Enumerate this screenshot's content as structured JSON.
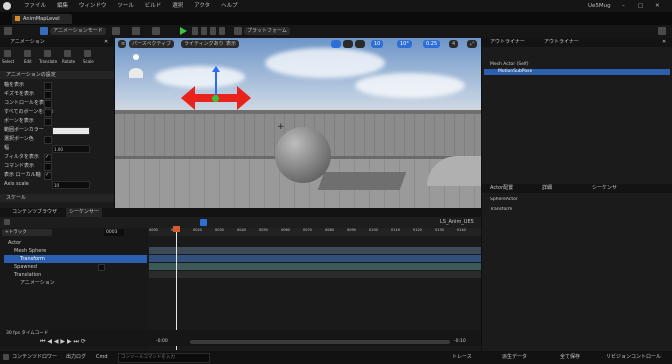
{
  "menubar": {
    "items": [
      "ファイル",
      "編集",
      "ウィンドウ",
      "ツール",
      "ビルド",
      "選択",
      "アクタ",
      "ヘルプ"
    ],
    "project": "Ue5Mug"
  },
  "tab": {
    "label": "AnimMapLevel"
  },
  "toolbar": {
    "mode_label": "アニメーションモード",
    "platform_label": "プラットフォーム"
  },
  "left_panel": {
    "title": "アニメーション",
    "tools": [
      "Select",
      "Edit",
      "Translate",
      "Rotate",
      "Scale"
    ],
    "section": "アニメーションの設定",
    "rows": [
      {
        "label": "軸を表示",
        "check": true
      },
      {
        "label": "ギズモを表示",
        "check": true
      },
      {
        "label": "コントロールを表示",
        "check": true
      },
      {
        "label": "すべてのボーンを表示",
        "check": false
      },
      {
        "label": "ボーンを表示",
        "check": false
      },
      {
        "label": "範囲ボーンカラー",
        "value": "swatch"
      },
      {
        "label": "選択ボーン色",
        "value": ""
      },
      {
        "label": "幅",
        "value": "1.00"
      },
      {
        "label": "フィルタを表示",
        "check": true
      },
      {
        "label": "コマンド表示",
        "check": false
      },
      {
        "label": "表示 ローカル軸",
        "check": true
      },
      {
        "label": "Axis scale",
        "value": "10"
      }
    ],
    "footer": "スケール"
  },
  "viewport": {
    "buttons": [
      "パースペクティブ",
      "ライティングあり",
      "表示"
    ],
    "snap_values": [
      "10",
      "10°",
      "0.25",
      "4"
    ]
  },
  "outliner": {
    "tabs": [
      "アウトライナー",
      "アウトライナー"
    ],
    "items": [
      "Mesh Actor (Self)",
      "MotionSubPose"
    ],
    "selected_item": "MotionSubPose"
  },
  "details": {
    "tabs": [
      "Actor配置",
      "詳細",
      "シーケンサ"
    ],
    "rows": [
      "SphereActor",
      "Transform"
    ]
  },
  "sequencer": {
    "tabs": [
      "コンテンツブラウザ",
      "シーケンサー"
    ],
    "track_button": "+トラック",
    "sequence_name": "LS_Anim_UE5",
    "frame": "0003",
    "tracks": [
      {
        "label": "Actor",
        "selected": false,
        "indent": 0
      },
      {
        "label": "Mesh Sphere",
        "selected": false,
        "indent": 1
      },
      {
        "label": "Transform",
        "selected": true,
        "indent": 2
      },
      {
        "label": "Spawned",
        "selected": false,
        "indent": 2
      },
      {
        "label": "Translation",
        "selected": false,
        "indent": 2
      },
      {
        "label": "アニメーション",
        "selected": false,
        "indent": 2
      }
    ],
    "footer_label": "30 fps タイムコード",
    "time_start": "-0:00",
    "time_end": "-0:10",
    "ruler_ticks": [
      "0000",
      "0010",
      "0020",
      "0030",
      "0040",
      "0050",
      "0060",
      "0070",
      "0080",
      "0090",
      "0100",
      "0110",
      "0120",
      "0130",
      "0140"
    ]
  },
  "statusbar": {
    "left": "コンテンツドロワー",
    "log": "出力ログ",
    "cmd": "Cmd",
    "cmd_placeholder": "コンソールコマンドを入力",
    "right": [
      "トレース",
      "派生データ",
      "全て保存",
      "リビジョンコントロール"
    ]
  },
  "colors": {
    "accent": "#2d6fd6",
    "gizmo_red": "#e8231c",
    "gizmo_blue": "#2b6df0",
    "gizmo_green": "#36c33a"
  }
}
